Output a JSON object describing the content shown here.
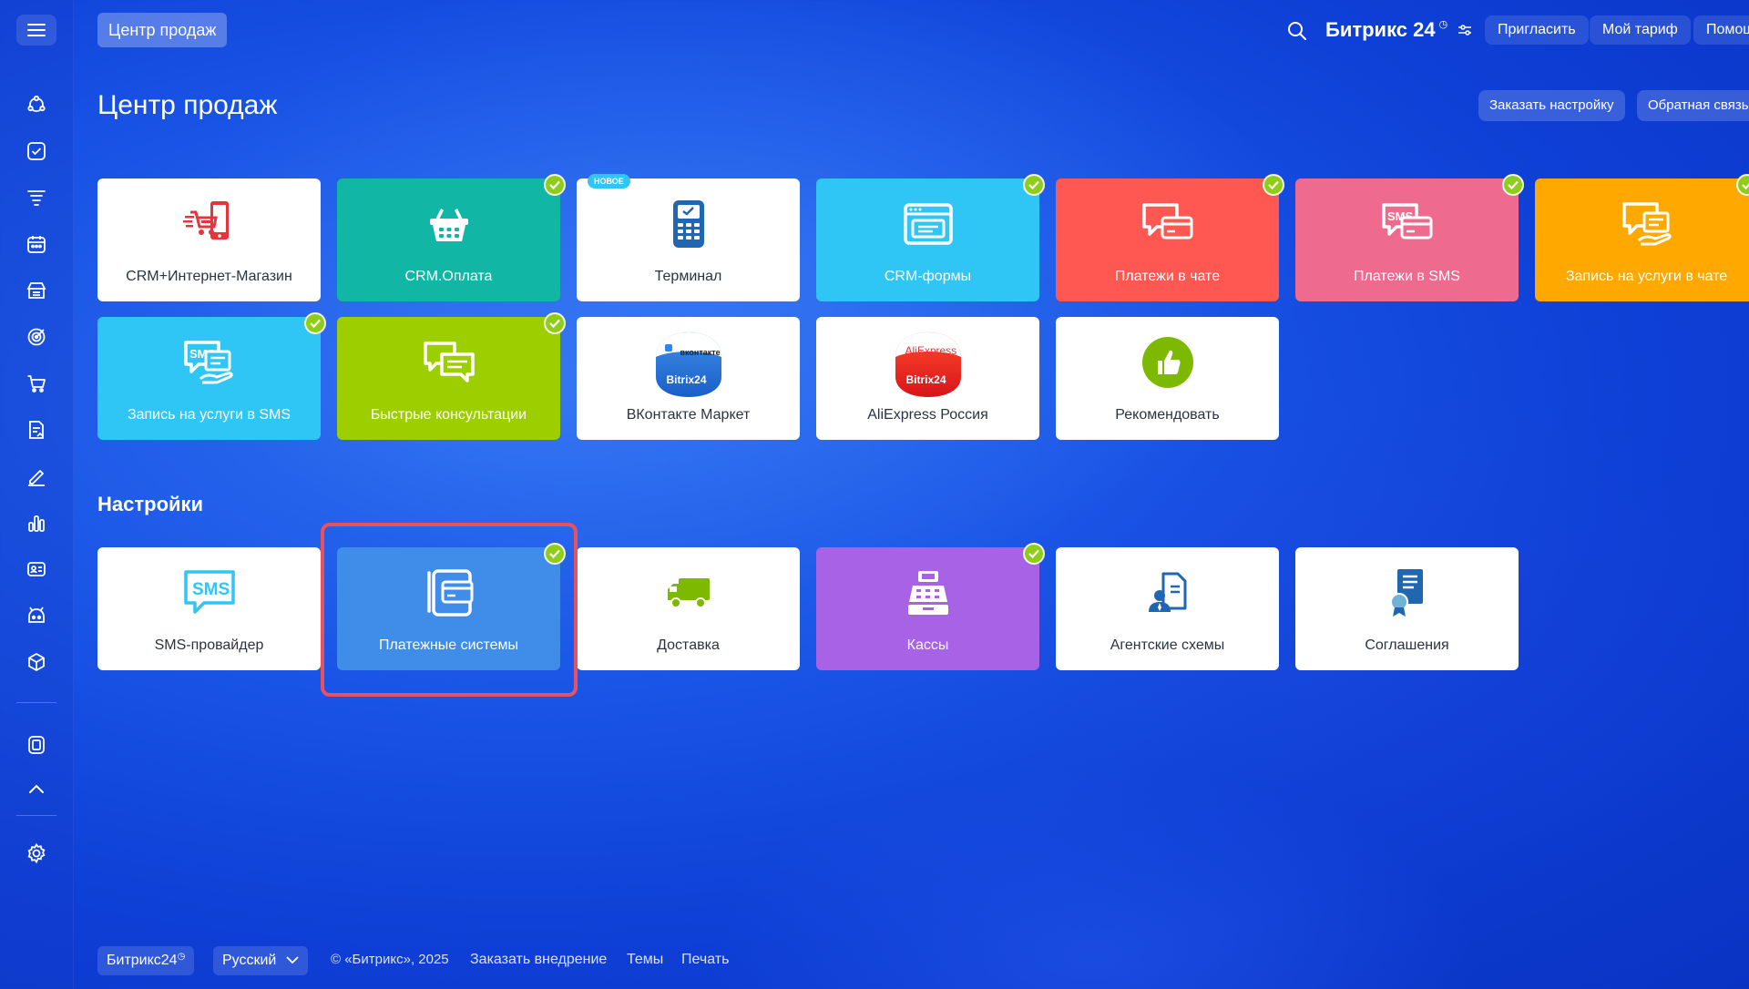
{
  "header": {
    "title_button": "Центр продаж",
    "brand": "Битрикс 24",
    "invite": "Пригласить",
    "tariff": "Мой тариф",
    "help": "Помощ"
  },
  "page": {
    "title": "Центр продаж",
    "order_setup": "Заказать настройку",
    "feedback": "Обратная связь"
  },
  "sidebar": {
    "icons": [
      "crm-icon",
      "tasks-icon",
      "funnel-icon",
      "calendar-icon",
      "store-icon",
      "target-icon",
      "cart-icon",
      "documents-icon",
      "sign-icon",
      "analytics-icon",
      "contacts-icon",
      "robot-icon",
      "box-icon",
      "marketplace-icon",
      "collapse-icon",
      "settings-icon"
    ]
  },
  "tiles_main": [
    {
      "label": "CRM+Интернет-Магазин",
      "color": "#ffffff",
      "icon": "shop-cart-icon",
      "checked": false
    },
    {
      "label": "CRM.Оплата",
      "color": "#11b7a4",
      "icon": "basket-icon",
      "checked": true
    },
    {
      "label": "Терминал",
      "color": "#ffffff",
      "icon": "terminal-icon",
      "checked": false,
      "badge": "НОВОЕ"
    },
    {
      "label": "CRM-формы",
      "color": "#2fc6f6",
      "icon": "form-icon",
      "checked": true
    },
    {
      "label": "Платежи в чате",
      "color": "#ff5752",
      "icon": "chat-payment-icon",
      "checked": true
    },
    {
      "label": "Платежи в SMS",
      "color": "#ee6a8f",
      "icon": "sms-payment-icon",
      "checked": true
    },
    {
      "label": "Запись на услуги в чате",
      "color": "#ffa900",
      "icon": "chat-booking-icon",
      "checked": true
    },
    {
      "label": "Запись на услуги в SMS",
      "color": "#2fc6f6",
      "icon": "sms-booking-icon",
      "checked": true
    },
    {
      "label": "Быстрые консультации",
      "color": "#9dcf00",
      "icon": "consult-icon",
      "checked": true
    },
    {
      "label": "ВКонтакте Маркет",
      "color": "#ffffff",
      "icon": "vk-market-icon",
      "checked": false
    },
    {
      "label": "AliExpress Россия",
      "color": "#ffffff",
      "icon": "aliexpress-icon",
      "checked": false
    },
    {
      "label": "Рекомендовать",
      "color": "#ffffff",
      "icon": "thumbs-up-icon",
      "checked": false
    }
  ],
  "settings": {
    "title": "Настройки",
    "tiles": [
      {
        "label": "SMS-провайдер",
        "color": "#ffffff",
        "icon": "sms-icon",
        "checked": false
      },
      {
        "label": "Платежные системы",
        "color": "#3f8de8",
        "icon": "payment-systems-icon",
        "checked": true,
        "highlighted": true
      },
      {
        "label": "Доставка",
        "color": "#ffffff",
        "icon": "truck-icon",
        "checked": false
      },
      {
        "label": "Кассы",
        "color": "#a762e6",
        "icon": "cash-register-icon",
        "checked": true
      },
      {
        "label": "Агентские схемы",
        "color": "#ffffff",
        "icon": "agent-icon",
        "checked": false
      },
      {
        "label": "Соглашения",
        "color": "#ffffff",
        "icon": "agreement-icon",
        "checked": false
      }
    ]
  },
  "vk_logo": {
    "top": "вконтакте",
    "bottom": "Bitrix24"
  },
  "ali_logo": {
    "top": "AliExpress",
    "bottom": "Bitrix24"
  },
  "footer": {
    "brand": "Битрикс24",
    "language": "Русский",
    "copyright": "© «Битрикс», 2025",
    "order_impl": "Заказать внедрение",
    "themes": "Темы",
    "print": "Печать"
  }
}
